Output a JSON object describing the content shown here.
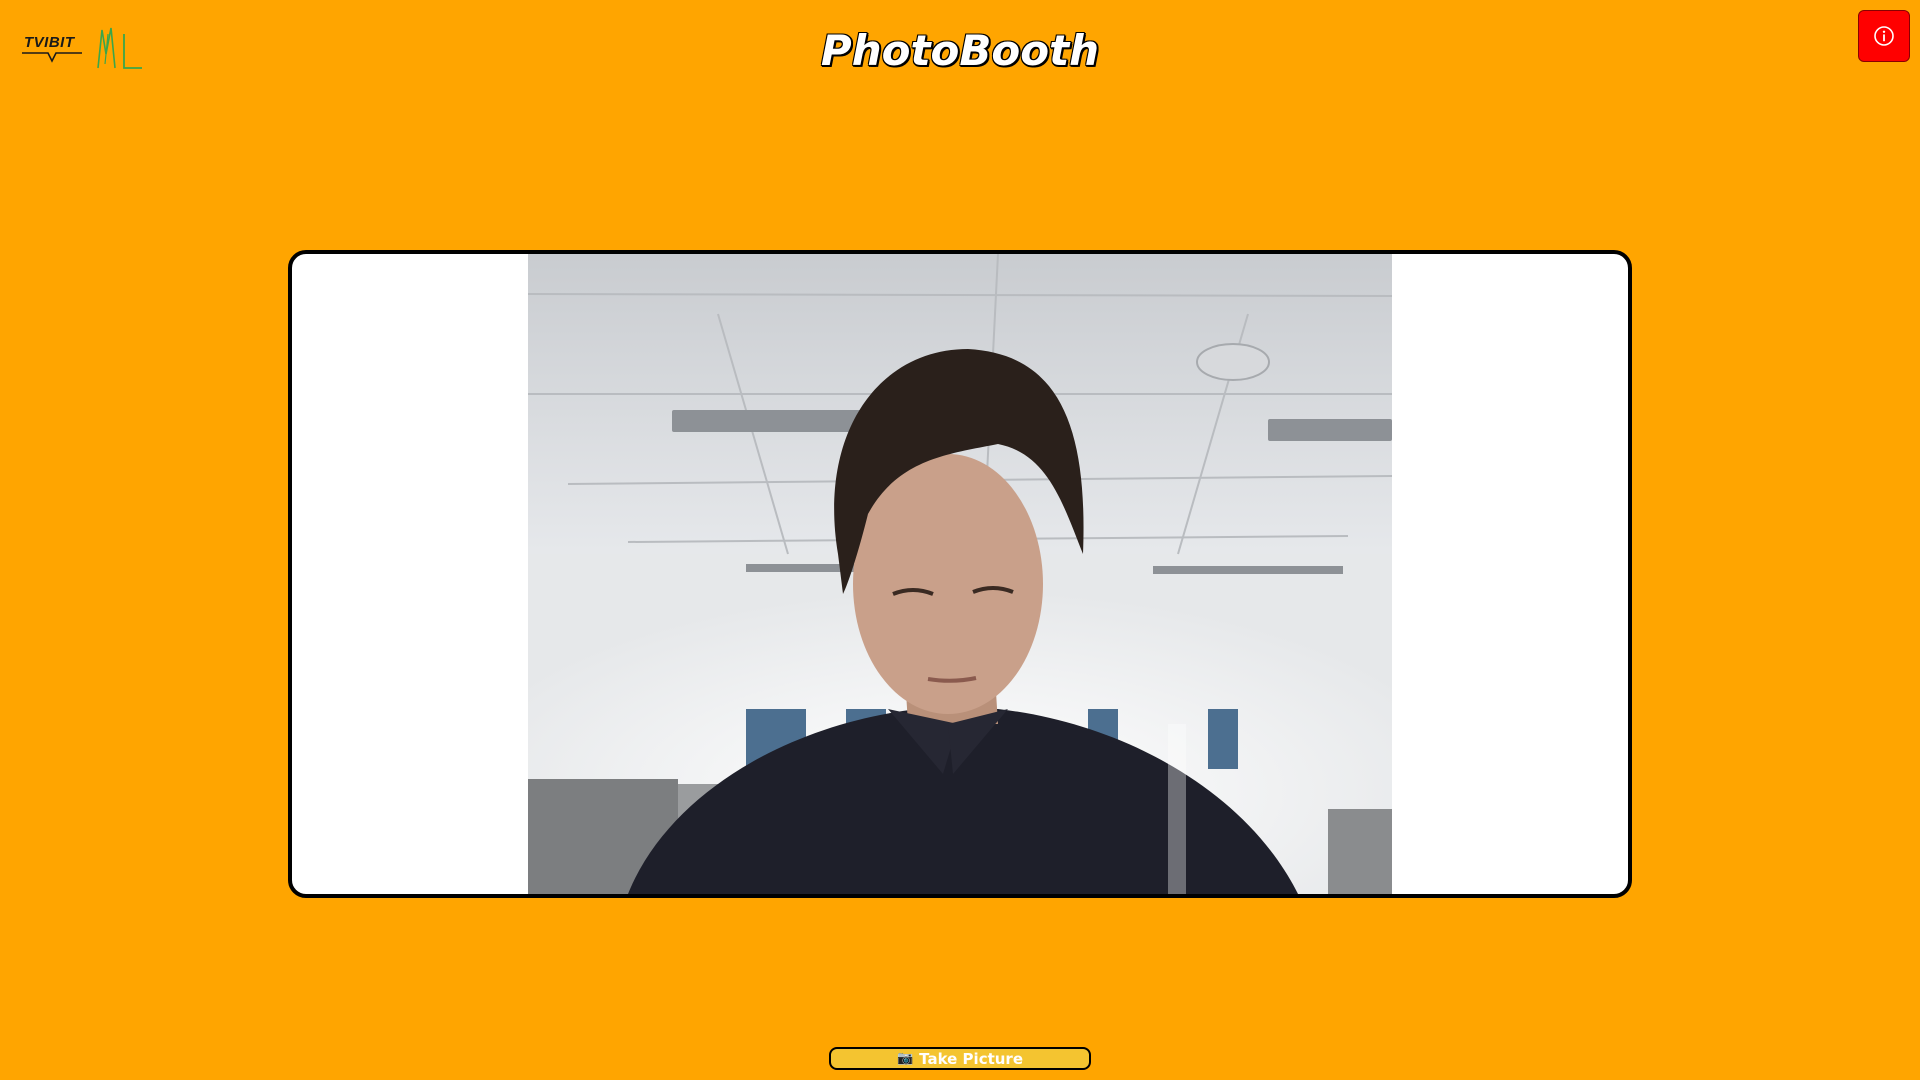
{
  "header": {
    "title": "PhotoBooth",
    "logos": {
      "left_logo": "TVIBIT",
      "right_logo": "ML"
    },
    "info_icon": "info-icon"
  },
  "colors": {
    "background": "#FFA500",
    "info_button": "#FF0000",
    "take_picture_button": "#F4C430",
    "frame_border": "#000000"
  },
  "camera": {
    "feed_icon": "camera-feed"
  },
  "actions": {
    "take_picture_icon": "camera-icon",
    "take_picture_label": "Take Picture"
  }
}
